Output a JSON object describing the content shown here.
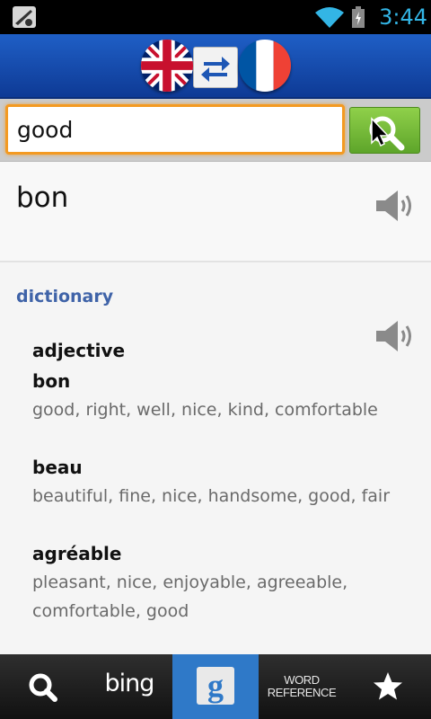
{
  "status_bar": {
    "time": "3:44",
    "clock_color": "#33b5e5"
  },
  "header": {
    "source_language_flag": "uk-flag-icon",
    "target_language_flag": "france-flag-icon",
    "swap_icon": "swap-arrows-icon"
  },
  "search": {
    "query": "good",
    "button_icon": "magnifier-icon"
  },
  "translation": {
    "word": "bon",
    "audio_icon": "speaker-icon"
  },
  "dictionary": {
    "heading": "dictionary",
    "part_of_speech": "adjective",
    "entries": [
      {
        "word": "bon",
        "synonyms": "good, right, well, nice, kind, comfortable"
      },
      {
        "word": "beau",
        "synonyms": "beautiful, fine, nice, handsome, good, fair"
      },
      {
        "word": "agréable",
        "synonyms": "pleasant, nice, enjoyable, agreeable, comfortable, good"
      }
    ]
  },
  "bottom_nav": {
    "tabs": [
      {
        "icon": "search-icon"
      },
      {
        "label": "bing"
      },
      {
        "icon": "google-icon",
        "active": true
      },
      {
        "label_line1": "WORD",
        "label_line2": "REFERENCE"
      },
      {
        "icon": "star-icon"
      }
    ]
  },
  "colors": {
    "header_blue": "#1f5fc6",
    "accent_orange": "#f39a22",
    "search_green": "#6fb535",
    "dictionary_heading": "#3f63a8",
    "active_tab": "#2f79c8"
  }
}
